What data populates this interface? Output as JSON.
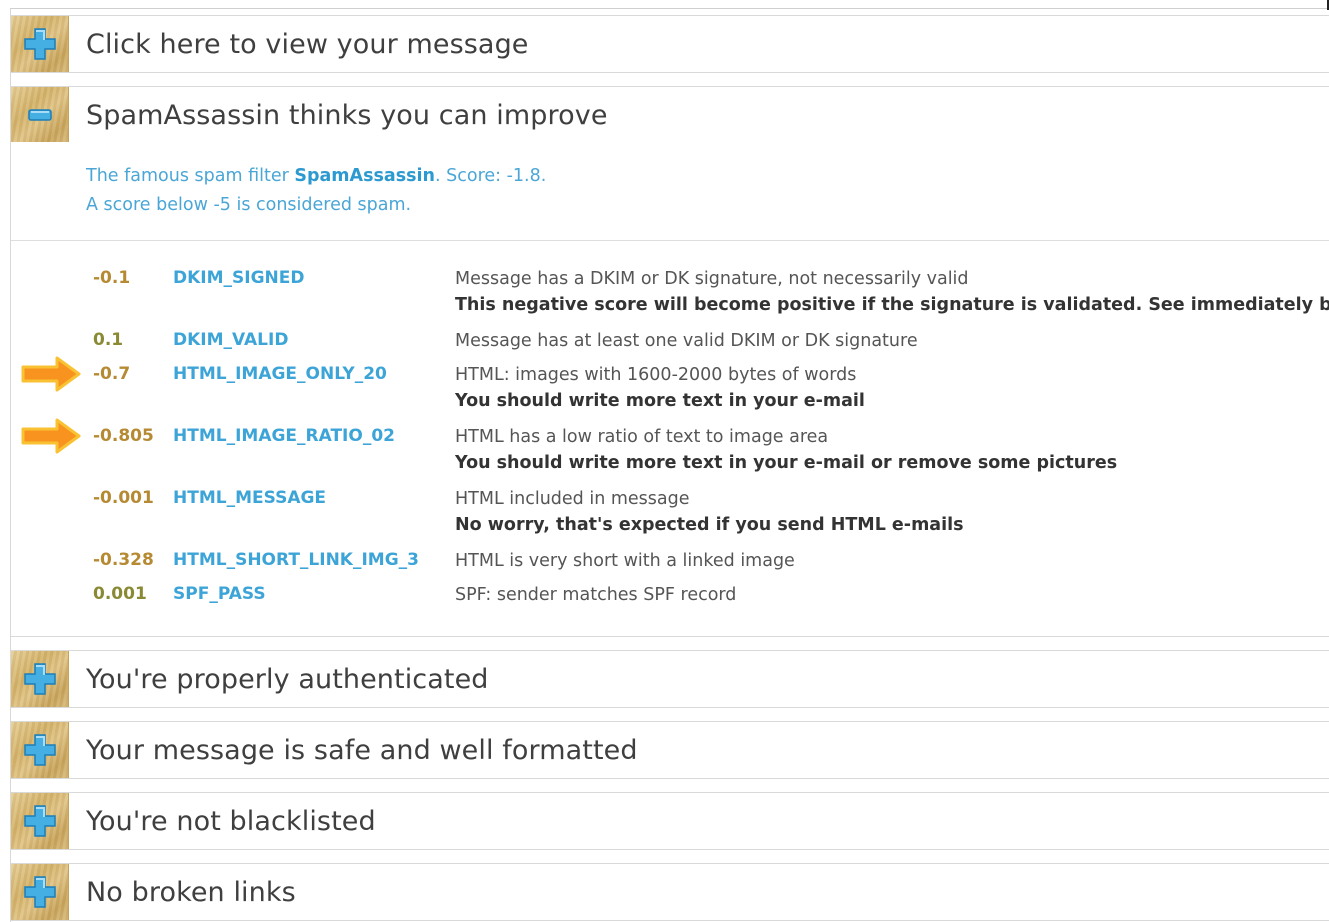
{
  "sections": {
    "view_message": {
      "title": "Click here to view your message",
      "state": "collapsed"
    },
    "spamassassin": {
      "title": "SpamAssassin thinks you can improve",
      "state": "expanded",
      "intro_prefix": "The famous spam filter ",
      "intro_brand": "SpamAssassin",
      "intro_score": ". Score: -1.8.",
      "intro_line2": "A score below -5 is considered spam.",
      "rules": [
        {
          "score": "-0.1",
          "name": "DKIM_SIGNED",
          "description": "Message has a DKIM or DK signature, not necessarily valid",
          "advice": "This negative score will become positive if the signature is validated. See immediately bel",
          "highlighted": false
        },
        {
          "score": "0.1",
          "name": "DKIM_VALID",
          "description": "Message has at least one valid DKIM or DK signature",
          "advice": "",
          "highlighted": false
        },
        {
          "score": "-0.7",
          "name": "HTML_IMAGE_ONLY_20",
          "description": "HTML: images with 1600-2000 bytes of words",
          "advice": "You should write more text in your e-mail",
          "highlighted": true
        },
        {
          "score": "-0.805",
          "name": "HTML_IMAGE_RATIO_02",
          "description": "HTML has a low ratio of text to image area",
          "advice": "You should write more text in your e-mail or remove some pictures",
          "highlighted": true
        },
        {
          "score": "-0.001",
          "name": "HTML_MESSAGE",
          "description": "HTML included in message",
          "advice": "No worry, that's expected if you send HTML e-mails",
          "highlighted": false
        },
        {
          "score": "-0.328",
          "name": "HTML_SHORT_LINK_IMG_3",
          "description": "HTML is very short with a linked image",
          "advice": "",
          "highlighted": false
        },
        {
          "score": "0.001",
          "name": "SPF_PASS",
          "description": "SPF: sender matches SPF record",
          "advice": "",
          "highlighted": false
        }
      ]
    },
    "authenticated": {
      "title": "You're properly authenticated",
      "state": "collapsed"
    },
    "safe_formatted": {
      "title": "Your message is safe and well formatted",
      "state": "collapsed"
    },
    "blacklisted": {
      "title": "You're not blacklisted",
      "state": "collapsed"
    },
    "broken_links": {
      "title": "No broken links",
      "state": "collapsed"
    }
  },
  "colors": {
    "accent_blue": "#3da4d8",
    "score_gold": "#b58a33",
    "arrow_orange": "#f7931e"
  }
}
